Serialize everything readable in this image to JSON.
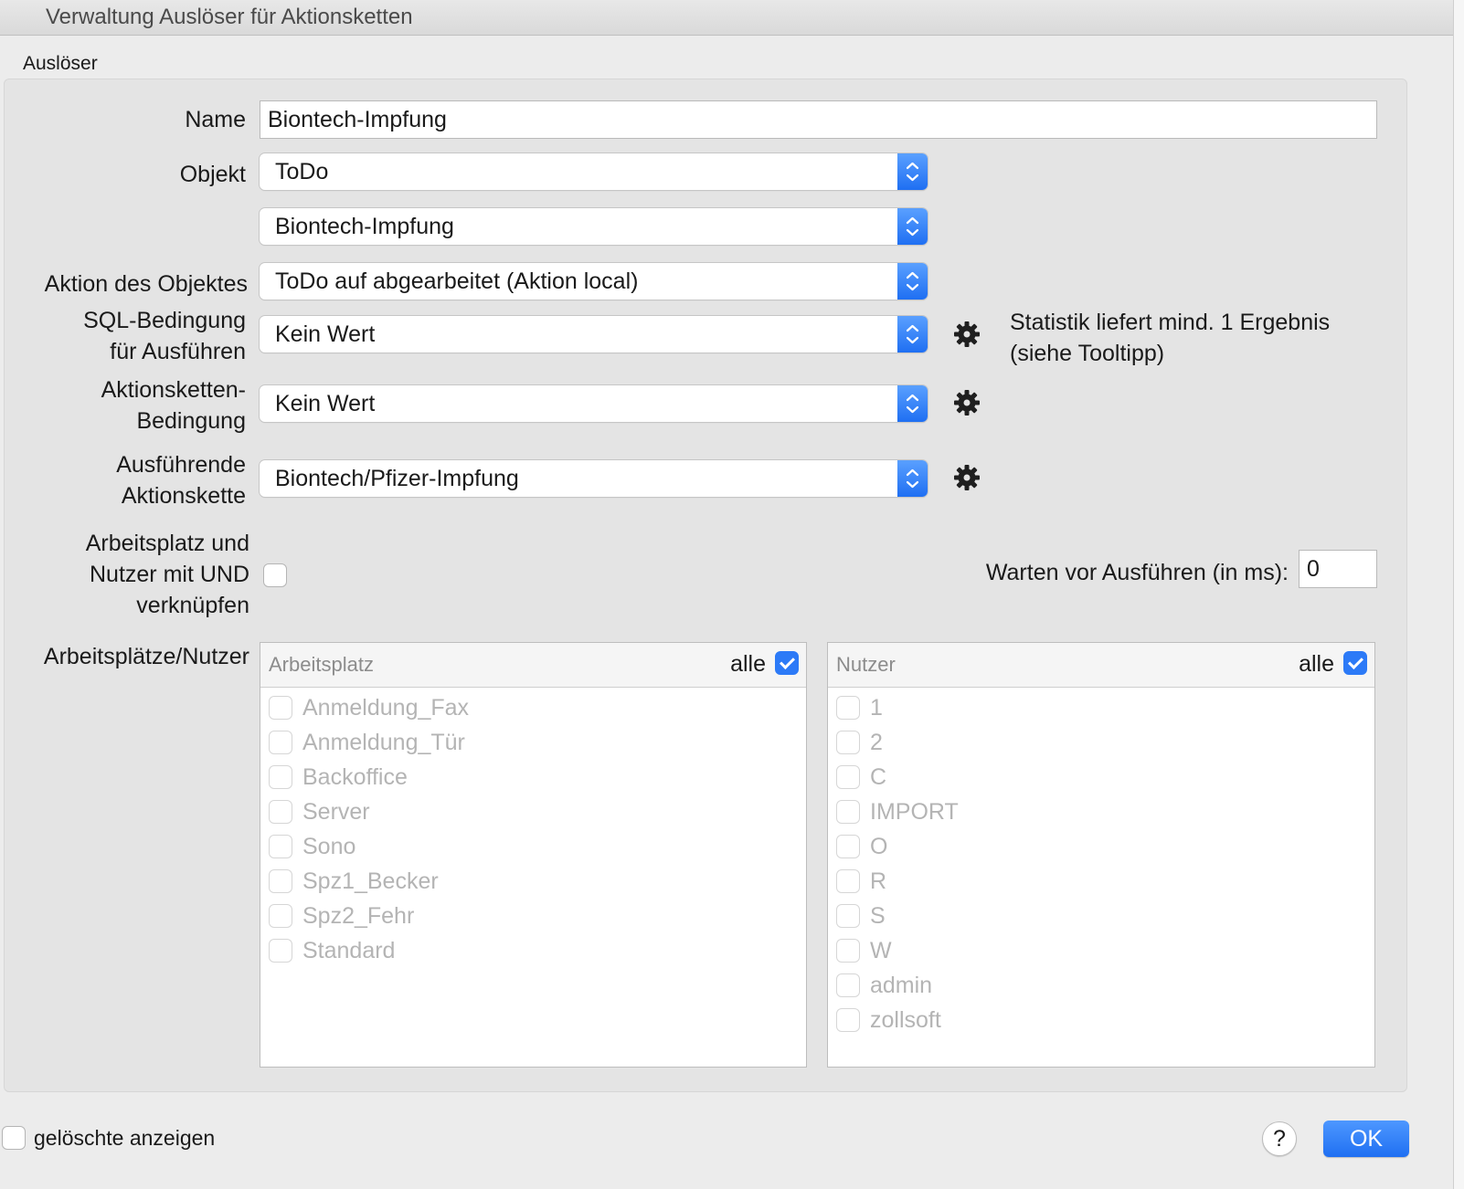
{
  "window": {
    "title": "Verwaltung Auslöser für Aktionsketten"
  },
  "group": {
    "label": "Auslöser"
  },
  "form": {
    "name_label": "Name",
    "name_value": "Biontech-Impfung",
    "objekt_label": "Objekt",
    "objekt_value": "ToDo",
    "objekt_sub_value": "Biontech-Impfung",
    "aktion_label": "Aktion des Objektes",
    "aktion_value": "ToDo auf abgearbeitet (Aktion local)",
    "sql_label_1": "SQL-Bedingung",
    "sql_label_2": "für Ausführen",
    "sql_value": "Kein Wert",
    "sql_note_1": "Statistik liefert mind. 1 Ergebnis",
    "sql_note_2": "(siehe Tooltipp)",
    "ak_label_1": "Aktionsketten-",
    "ak_label_2": "Bedingung",
    "ak_value": "Kein Wert",
    "exec_label_1": "Ausführende",
    "exec_label_2": "Aktionskette",
    "exec_value": "Biontech/Pfizer-Impfung",
    "und_label_1": "Arbeitsplatz und",
    "und_label_2": "Nutzer mit UND",
    "und_label_3": "verknüpfen",
    "wait_label": "Warten vor Ausführen (in ms):",
    "wait_value": "0",
    "lists_label": "Arbeitsplätze/Nutzer"
  },
  "arbeitsplatz": {
    "header": "Arbeitsplatz",
    "all_label": "alle",
    "items": [
      "Anmeldung_Fax",
      "Anmeldung_Tür",
      "Backoffice",
      "Server",
      "Sono",
      "Spz1_Becker",
      "Spz2_Fehr",
      "Standard"
    ]
  },
  "nutzer": {
    "header": "Nutzer",
    "all_label": "alle",
    "items": [
      "1",
      "2",
      "C",
      "IMPORT",
      "O",
      "R",
      "S",
      "W",
      "admin",
      "zollsoft"
    ]
  },
  "footer": {
    "show_deleted_label": "gelöschte anzeigen",
    "help_label": "?",
    "ok_label": "OK"
  },
  "icons": {
    "gear": "gear-icon",
    "stepper": "chevron-updown-icon",
    "check": "checkmark-icon"
  },
  "colors": {
    "accent": "#2c7af7",
    "disabled_text": "#b4b4b4"
  }
}
